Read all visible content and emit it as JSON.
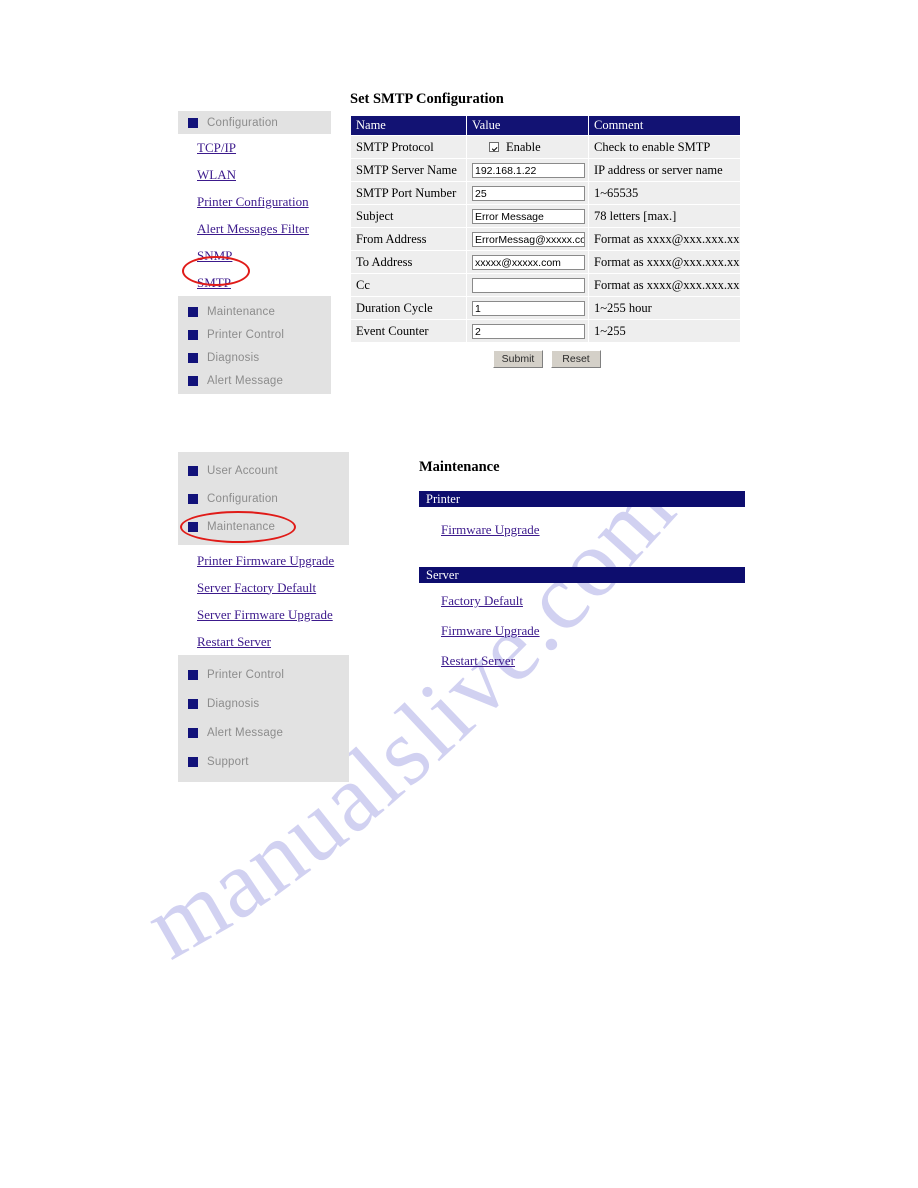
{
  "watermark": {
    "text": "manualslive.com"
  },
  "top_section": {
    "nav": {
      "groups": [
        {
          "header": "Configuration",
          "links": [
            "TCP/IP",
            "WLAN",
            "Printer Configuration",
            "Alert Messages Filter",
            "SNMP",
            "SMTP"
          ]
        }
      ],
      "collapsed": [
        "Maintenance",
        "Printer Control",
        "Diagnosis",
        "Alert Message"
      ],
      "highlighted_item": "SMTP"
    },
    "title": "Set SMTP Configuration",
    "table": {
      "headers": [
        "Name",
        "Value",
        "Comment"
      ],
      "rows": [
        {
          "name": "SMTP Protocol",
          "value_type": "checkbox",
          "value": "Enable",
          "checked": true,
          "comment": "Check to enable SMTP"
        },
        {
          "name": "SMTP Server Name",
          "value_type": "text",
          "value": "192.168.1.22",
          "comment": "IP address or server name"
        },
        {
          "name": "SMTP Port Number",
          "value_type": "text",
          "value": "25",
          "comment": "1~65535"
        },
        {
          "name": "Subject",
          "value_type": "text",
          "value": "Error Message",
          "comment": "78 letters [max.]"
        },
        {
          "name": "From Address",
          "value_type": "text",
          "value": "ErrorMessag@xxxxx.com",
          "comment": "Format as xxxx@xxx.xxx.xx"
        },
        {
          "name": "To Address",
          "value_type": "text",
          "value": "xxxxx@xxxxx.com",
          "comment": "Format as xxxx@xxx.xxx.xx"
        },
        {
          "name": "Cc",
          "value_type": "text",
          "value": "",
          "comment": "Format as xxxx@xxx.xxx.xx"
        },
        {
          "name": "Duration Cycle",
          "value_type": "text",
          "value": "1",
          "comment": "1~255 hour"
        },
        {
          "name": "Event Counter",
          "value_type": "text",
          "value": "2",
          "comment": "1~255"
        }
      ]
    },
    "buttons": {
      "submit": "Submit",
      "reset": "Reset"
    }
  },
  "bottom_section": {
    "nav": {
      "top_items": [
        "User Account",
        "Configuration",
        "Maintenance"
      ],
      "links": [
        "Printer Firmware Upgrade",
        "Server Factory Default",
        "Server Firmware Upgrade",
        "Restart Server"
      ],
      "bottom_items": [
        "Printer Control",
        "Diagnosis",
        "Alert Message",
        "Support"
      ],
      "highlighted_item": "Maintenance"
    },
    "title": "Maintenance",
    "groups": [
      {
        "bar": "Printer",
        "links": [
          "Firmware Upgrade"
        ]
      },
      {
        "bar": "Server",
        "links": [
          "Factory Default",
          "Firmware Upgrade",
          "Restart Server"
        ]
      }
    ]
  },
  "colors": {
    "bar_navy": "#0d0d6e",
    "table_header_navy": "#121273",
    "link_purple": "#3c1a8c",
    "nav_panel_gray": "#e2e2e2",
    "annotation_red": "#e01b18",
    "watermark_lavender": "#c9c9ef"
  }
}
